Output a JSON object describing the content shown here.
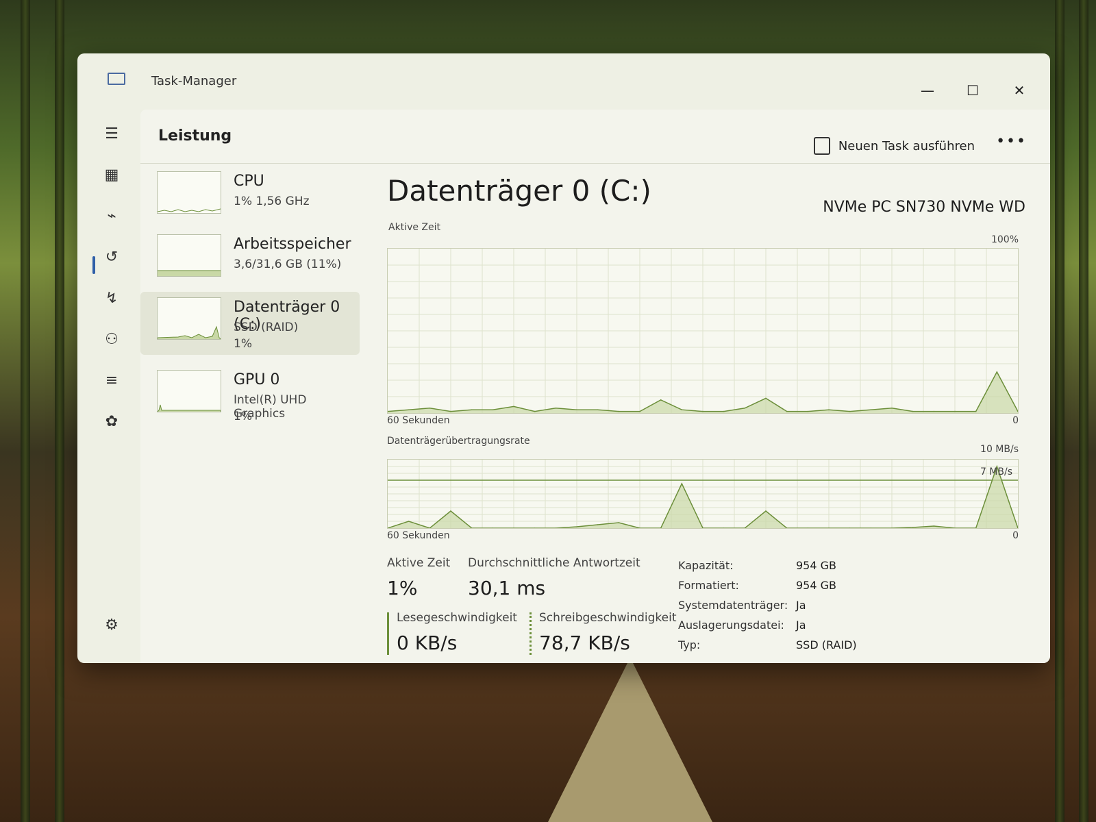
{
  "window": {
    "title": "Task-Manager",
    "minimize": "—",
    "maximize": "☐",
    "close": "✕"
  },
  "header": {
    "page_title": "Leistung",
    "run_task_label": "Neuen Task ausführen",
    "more_label": "•••"
  },
  "devices": [
    {
      "name": "CPU",
      "sub": "1%  1,56 GHz",
      "sub2": ""
    },
    {
      "name": "Arbeitsspeicher",
      "sub": "3,6/31,6 GB (11%)",
      "sub2": ""
    },
    {
      "name": "Datenträger 0 (C:)",
      "sub": "SSD (RAID)",
      "sub2": "1%"
    },
    {
      "name": "GPU 0",
      "sub": "Intel(R) UHD Graphics",
      "sub2": "1%"
    }
  ],
  "detail": {
    "title": "Datenträger 0 (C:)",
    "model": "NVMe PC SN730 NVMe WD",
    "active_time_graph": {
      "label": "Aktive Zeit",
      "max_label": "100%",
      "x_label": "60 Sekunden",
      "min_label": "0"
    },
    "transfer_graph": {
      "label": "Datenträgerübertragungsrate",
      "max_label": "10 MB/s",
      "ref_label": "7 MB/s",
      "x_label": "60 Sekunden",
      "min_label": "0"
    },
    "stats": {
      "active_time_label": "Aktive Zeit",
      "active_time_value": "1%",
      "avg_response_label": "Durchschnittliche Antwortzeit",
      "avg_response_value": "30,1 ms",
      "read_label": "Lesegeschwindigkeit",
      "read_value": "0 KB/s",
      "write_label": "Schreibgeschwindigkeit",
      "write_value": "78,7 KB/s"
    },
    "properties": [
      {
        "key": "Kapazität:",
        "value": "954 GB"
      },
      {
        "key": "Formatiert:",
        "value": "954 GB"
      },
      {
        "key": "Systemdatenträger:",
        "value": "Ja"
      },
      {
        "key": "Auslagerungsdatei:",
        "value": "Ja"
      },
      {
        "key": "Typ:",
        "value": "SSD (RAID)"
      }
    ]
  },
  "nav_icons": [
    "menu-icon",
    "processes-icon",
    "performance-icon",
    "app-history-icon",
    "startup-icon",
    "users-icon",
    "details-icon",
    "services-icon",
    "settings-icon"
  ],
  "colors": {
    "accent": "#2f5fa8",
    "graph_line": "#6c8f3a",
    "graph_fill": "#c9d8a6"
  },
  "chart_data": [
    {
      "type": "area",
      "title": "Aktive Zeit",
      "xlabel": "60 Sekunden",
      "ylim": [
        0,
        100
      ],
      "x": [
        0,
        2,
        4,
        6,
        8,
        10,
        12,
        14,
        16,
        18,
        20,
        22,
        24,
        26,
        28,
        30,
        32,
        34,
        36,
        38,
        40,
        42,
        44,
        46,
        48,
        50,
        52,
        54,
        56,
        58,
        60
      ],
      "values": [
        1,
        2,
        3,
        1,
        2,
        2,
        4,
        1,
        3,
        2,
        2,
        1,
        1,
        8,
        2,
        1,
        1,
        3,
        9,
        1,
        1,
        2,
        1,
        2,
        3,
        1,
        1,
        1,
        1,
        25,
        1
      ]
    },
    {
      "type": "area",
      "title": "Datenträgerübertragungsrate",
      "xlabel": "60 Sekunden",
      "ylim": [
        0,
        10
      ],
      "x": [
        0,
        2,
        4,
        6,
        8,
        10,
        12,
        14,
        16,
        18,
        20,
        22,
        24,
        26,
        28,
        30,
        32,
        34,
        36,
        38,
        40,
        42,
        44,
        46,
        48,
        50,
        52,
        54,
        56,
        58,
        60
      ],
      "values": [
        0,
        1,
        0,
        2.5,
        0,
        0,
        0,
        0,
        0,
        0.2,
        0.5,
        0.8,
        0,
        0,
        6.5,
        0,
        0,
        0,
        2.5,
        0,
        0,
        0,
        0,
        0,
        0,
        0.1,
        0.3,
        0,
        0,
        9,
        0
      ]
    }
  ]
}
